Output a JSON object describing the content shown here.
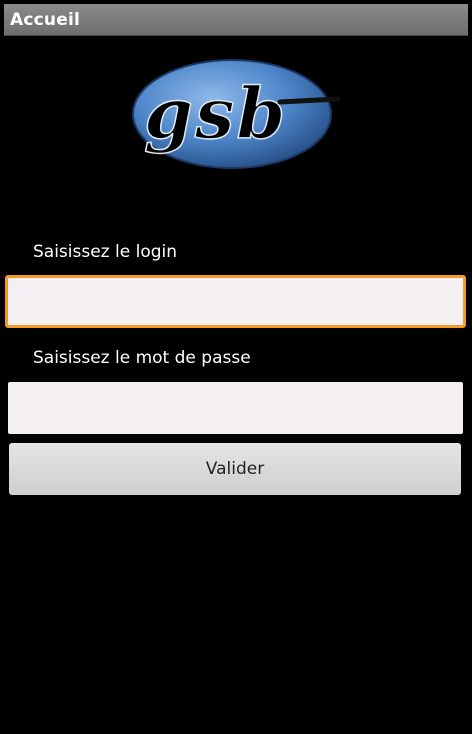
{
  "header": {
    "title": "Accueil"
  },
  "logo": {
    "text": "gsb",
    "colors": {
      "ellipse": "#4d86c9",
      "ellipse_dark": "#264c85",
      "ink": "#111111"
    }
  },
  "form": {
    "login_label": "Saisissez le login",
    "login_value": "",
    "password_label": "Saisissez le mot de passe",
    "password_value": "",
    "submit_label": "Valider"
  },
  "colors": {
    "background": "#000000",
    "titlebar": "#7c7c7c",
    "focus_border": "#f39a28",
    "input_bg": "#f3eff3",
    "button_bg": "#d9d9d9"
  }
}
